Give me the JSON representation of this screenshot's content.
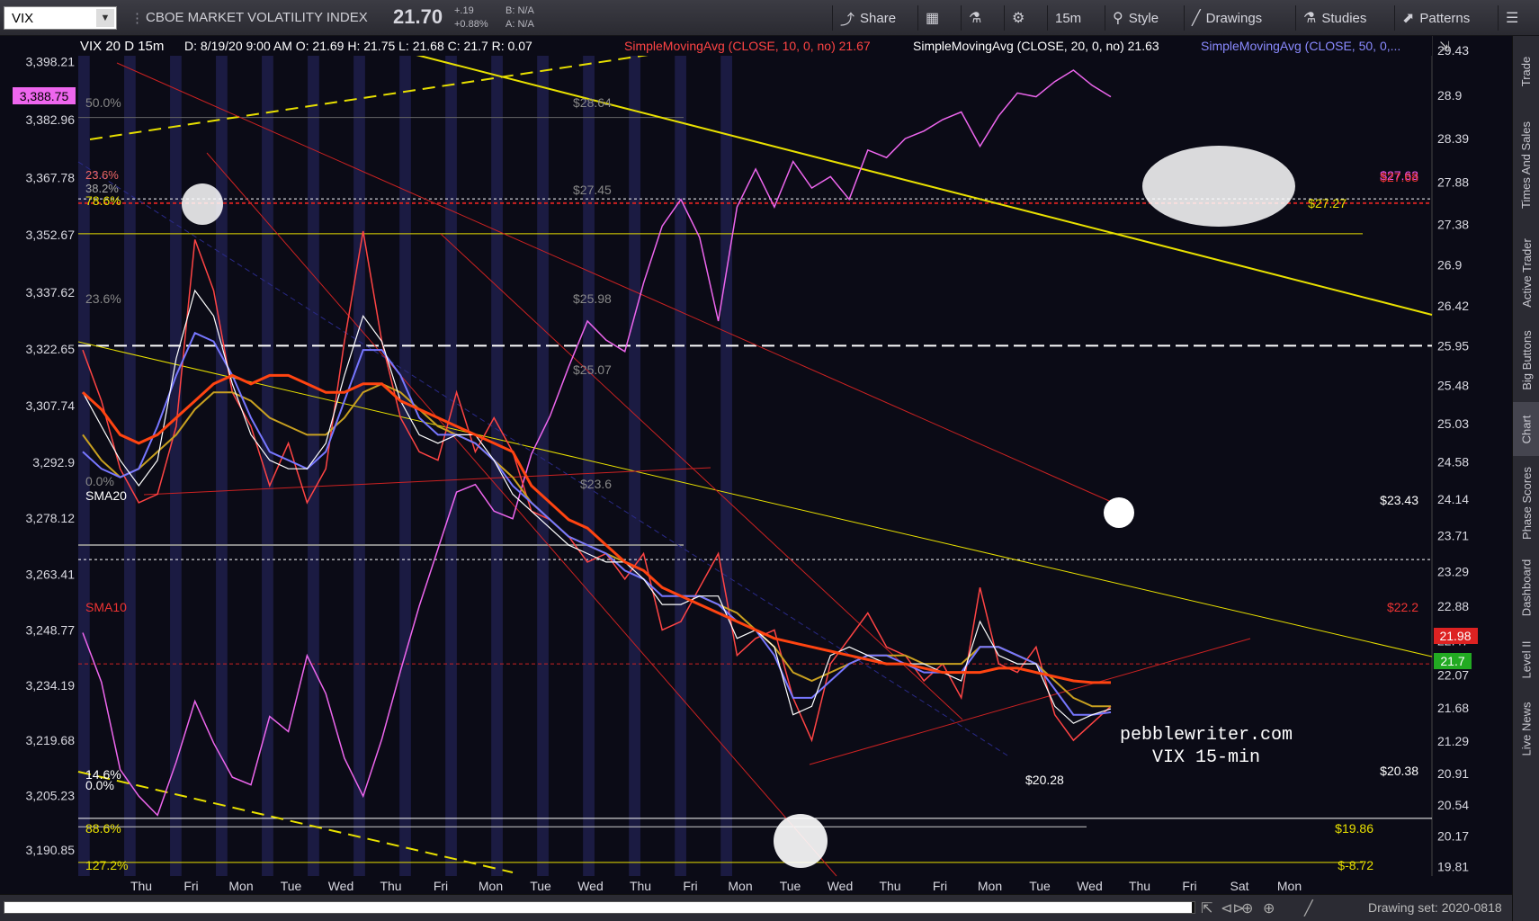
{
  "toolbar": {
    "symbol": "VIX",
    "description": "CBOE MARKET VOLATILITY INDEX",
    "last_price": "21.70",
    "change": "+.19",
    "change_pct": "+0.88%",
    "bid": "B: N/A",
    "ask": "A: N/A",
    "share_label": "Share",
    "timeframe": "15m",
    "style_label": "Style",
    "drawings_label": "Drawings",
    "studies_label": "Studies",
    "patterns_label": "Patterns"
  },
  "header": {
    "symbol_line": "VIX 20 D 15m",
    "ohlc": "D: 8/19/20 9:00 AM  O: 21.69  H: 21.75  L: 21.68  C: 21.7  R: 0.07",
    "sma10": "SimpleMovingAvg (CLOSE, 10, 0, no)  21.67",
    "sma20": "SimpleMovingAvg (CLOSE, 20, 0, no)  21.63",
    "sma50": "SimpleMovingAvg (CLOSE, 50, 0,..."
  },
  "right_panel": [
    "Trade",
    "Times And Sales",
    "Active Trader",
    "Big Buttons",
    "Chart",
    "Phase Scores",
    "Dashboard",
    "Level II",
    "Live News"
  ],
  "bottom": {
    "drawing_set": "Drawing set: 2020-0818"
  },
  "watermark": {
    "line1": "pebblewriter.com",
    "line2": "VIX 15-min"
  },
  "colors": {
    "bg": "#0b0b16",
    "stripe": "#22224a",
    "vix": "#ff4444",
    "vix_up": "#33cc33",
    "spx": "#ee66ee",
    "sma10": "#ffffff",
    "sma20": "#7777ff",
    "sma50": "#c8a020",
    "sma200": "#ff4411",
    "yellow": "#e8e000",
    "red_line": "#cc2222"
  },
  "chart_data": {
    "type": "line",
    "x_labels": [
      "Thu",
      "Fri",
      "Mon",
      "Tue",
      "Wed",
      "Thu",
      "Fri",
      "Mon",
      "Tue",
      "Wed",
      "Thu",
      "Fri",
      "Mon",
      "Tue",
      "Wed",
      "Thu",
      "Fri",
      "Mon",
      "Tue",
      "Wed",
      "Thu",
      "Fri",
      "Sat",
      "Mon"
    ],
    "right_axis": {
      "ticks": [
        "29.43",
        "28.9",
        "28.39",
        "27.88",
        "27.38",
        "26.9",
        "26.42",
        "25.95",
        "25.48",
        "25.03",
        "24.58",
        "24.14",
        "23.71",
        "23.29",
        "22.88",
        "22.47",
        "22.07",
        "21.68",
        "21.29",
        "20.91",
        "20.54",
        "20.17",
        "19.81"
      ],
      "range": [
        19.7,
        29.6
      ]
    },
    "left_axis": {
      "ticks": [
        "3,398.21",
        "3,382.96",
        "3,367.78",
        "3,352.67",
        "3,337.62",
        "3,322.65",
        "3,307.74",
        "3,292.9",
        "3,278.12",
        "3,263.41",
        "3,248.77",
        "3,234.19",
        "3,219.68",
        "3,205.23",
        "3,190.85"
      ],
      "range": [
        3184,
        3405
      ]
    },
    "price_tags": {
      "spx_last": "3,388.75",
      "vix_sma": "21.98",
      "vix_last": "21.7",
      "top_tag_1": "$27.63",
      "top_tag_2": "$27.68",
      "yellow_tag": "$27.27",
      "red_tag": "$22.2",
      "white_tag": "$23.43",
      "low_tag": "$20.38",
      "low_line": "$20.28",
      "bottom_tag": "$19.86",
      "bottom_tag_2": "$-8.72"
    },
    "fib_labels": {
      "f50": "50.0%",
      "f236": "23.6%",
      "f0": "0.0%",
      "f786": "78.6%",
      "f382": "38.2%",
      "f236b": "23.6%",
      "f146": "14.6%",
      "f0b": "0.0%",
      "f886": "88.6%",
      "f1272": "127.2%",
      "v2864": "$28.64",
      "v2745": "$27.45",
      "v2598": "$25.98",
      "v2507": "$25.07",
      "v2356": "$23.6",
      "sma20": "SMA20",
      "sma10": "SMA10"
    },
    "series": [
      {
        "key": "vix",
        "values": [
          25.9,
          25.3,
          24.5,
          24.1,
          24.2,
          25.0,
          27.2,
          26.6,
          25.4,
          25.0,
          24.3,
          24.8,
          24.1,
          24.5,
          26.0,
          27.3,
          26.0,
          25.1,
          24.7,
          24.6,
          25.4,
          24.7,
          25.1,
          24.7,
          24.0,
          23.9,
          23.7,
          23.4,
          23.5,
          23.2,
          23.5,
          22.6,
          22.7,
          23.1,
          23.5,
          22.3,
          22.5,
          22.6,
          21.8,
          21.3,
          22.2,
          22.5,
          22.8,
          22.4,
          22.3,
          22.0,
          22.2,
          21.8,
          23.1,
          22.2,
          22.1,
          22.4,
          21.6,
          21.3,
          21.5,
          21.7
        ]
      },
      {
        "key": "sma10",
        "values": [
          25.4,
          25.0,
          24.6,
          24.3,
          24.6,
          25.8,
          26.6,
          26.3,
          25.5,
          24.9,
          24.6,
          24.5,
          24.5,
          24.8,
          25.6,
          26.3,
          26.0,
          25.3,
          24.9,
          24.8,
          24.9,
          24.9,
          24.6,
          24.2,
          24.0,
          23.8,
          23.6,
          23.5,
          23.4,
          23.4,
          23.2,
          22.9,
          22.9,
          23.0,
          23.0,
          22.5,
          22.6,
          22.4,
          21.6,
          21.7,
          22.3,
          22.4,
          22.3,
          22.2,
          22.2,
          22.2,
          22.1,
          22.0,
          22.7,
          22.3,
          22.2,
          22.2,
          21.7,
          21.5,
          21.6,
          21.67
        ]
      },
      {
        "key": "sma20",
        "values": [
          24.7,
          24.5,
          24.4,
          24.5,
          25.0,
          25.6,
          26.1,
          26.0,
          25.6,
          25.1,
          24.7,
          24.6,
          24.5,
          24.7,
          25.3,
          25.9,
          25.9,
          25.6,
          25.1,
          24.9,
          24.9,
          24.8,
          24.6,
          24.3,
          24.1,
          23.9,
          23.7,
          23.6,
          23.5,
          23.3,
          23.2,
          23.0,
          23.0,
          23.0,
          22.9,
          22.7,
          22.6,
          22.3,
          21.8,
          21.8,
          22.0,
          22.2,
          22.3,
          22.3,
          22.2,
          22.1,
          22.1,
          22.1,
          22.4,
          22.4,
          22.3,
          22.2,
          21.9,
          21.6,
          21.6,
          21.63
        ]
      },
      {
        "key": "sma50",
        "values": [
          24.9,
          24.6,
          24.4,
          24.5,
          24.7,
          24.9,
          25.2,
          25.4,
          25.4,
          25.3,
          25.1,
          25.0,
          24.9,
          24.9,
          25.1,
          25.4,
          25.5,
          25.4,
          25.2,
          25.0,
          24.9,
          24.8,
          24.6,
          24.4,
          24.1,
          23.9,
          23.7,
          23.6,
          23.5,
          23.4,
          23.3,
          23.1,
          23.0,
          23.0,
          22.9,
          22.8,
          22.6,
          22.4,
          22.1,
          22.0,
          22.1,
          22.2,
          22.3,
          22.3,
          22.3,
          22.2,
          22.2,
          22.2,
          22.4,
          22.4,
          22.3,
          22.2,
          22.0,
          21.8,
          21.7,
          21.7
        ]
      },
      {
        "key": "sma200",
        "values": [
          25.4,
          25.2,
          24.9,
          24.8,
          24.9,
          25.1,
          25.3,
          25.5,
          25.6,
          25.5,
          25.6,
          25.6,
          25.5,
          25.4,
          25.4,
          25.5,
          25.5,
          25.3,
          25.2,
          25.1,
          25.0,
          24.9,
          24.8,
          24.7,
          24.3,
          24.1,
          23.9,
          23.8,
          23.6,
          23.4,
          23.3,
          23.1,
          23.0,
          22.9,
          22.8,
          22.7,
          22.6,
          22.5,
          22.45,
          22.4,
          22.35,
          22.3,
          22.25,
          22.2,
          22.2,
          22.15,
          22.1,
          22.1,
          22.1,
          22.15,
          22.15,
          22.1,
          22.05,
          22.0,
          21.98,
          21.98
        ]
      },
      {
        "key": "spx",
        "values": [
          3248,
          3235,
          3212,
          3205,
          3200,
          3214,
          3230,
          3219,
          3210,
          3208,
          3226,
          3222,
          3242,
          3232,
          3215,
          3205,
          3220,
          3238,
          3255,
          3270,
          3285,
          3287,
          3280,
          3278,
          3295,
          3305,
          3318,
          3330,
          3325,
          3322,
          3340,
          3355,
          3362,
          3352,
          3330,
          3360,
          3370,
          3360,
          3372,
          3365,
          3368,
          3362,
          3375,
          3373,
          3378,
          3380,
          3383,
          3385,
          3376,
          3384,
          3390,
          3389,
          3393,
          3396,
          3392,
          3389
        ]
      }
    ]
  }
}
